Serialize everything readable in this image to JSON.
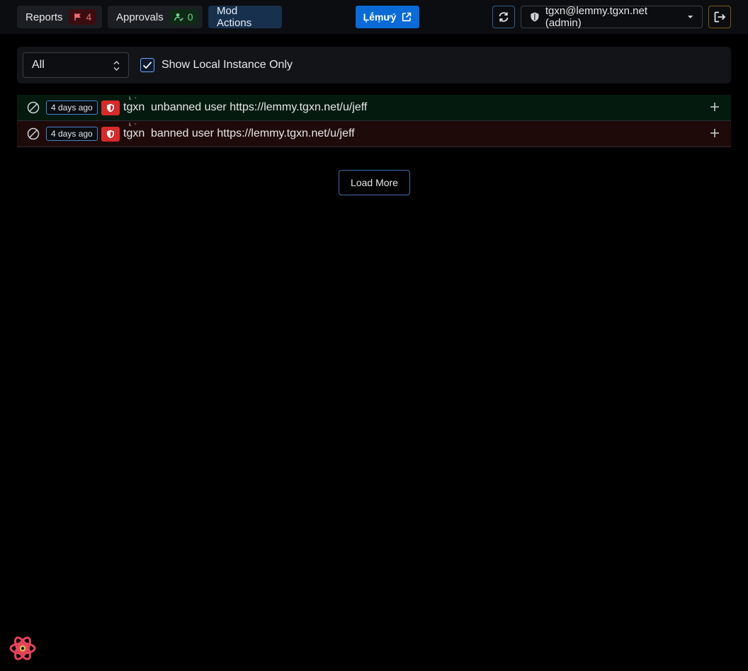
{
  "topbar": {
    "reports_label": "Reports",
    "reports_count": "4",
    "approvals_label": "Approvals",
    "approvals_count": "0",
    "mod_actions_label": "Mod Actions",
    "lemmy_label": "Ļḗṃưý",
    "user_label": "tgxn@lemmy.tgxn.net (admin)"
  },
  "filters": {
    "select_value": "All",
    "show_local_label": "Show Local Instance Only",
    "show_local_checked": true
  },
  "log_rows": [
    {
      "time": "4 days ago",
      "username": "tgxn",
      "action": "unbanned user https://lemmy.tgxn.net/u/jeff",
      "status_color": "#051a0e"
    },
    {
      "time": "4 days ago",
      "username": "tgxn",
      "action": "banned user https://lemmy.tgxn.net/u/jeff",
      "status_color": "#1f0a0a"
    }
  ],
  "load_more_label": "Load More",
  "colors": {
    "accent": "#0a6ad6",
    "admin_red": "#d62b2b",
    "report_red": "#f06a72",
    "approval_green": "#6fd18c"
  },
  "icons": {
    "reports": "flag-icon",
    "approvals": "user-check-icon",
    "lemmy": "external-link-icon",
    "refresh": "refresh-icon",
    "user": "shield-icon",
    "dropdown": "caret-down-icon",
    "logout": "logout-icon",
    "row_action": "ban-icon",
    "admin": "admin-shield-icon",
    "expand": "plus-icon",
    "corner": "react-logo-icon"
  }
}
